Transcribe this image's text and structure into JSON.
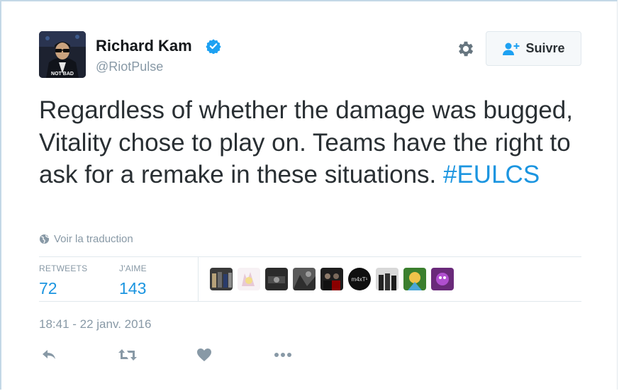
{
  "author": {
    "name": "Richard Kam",
    "handle": "@RiotPulse",
    "avatar_caption": "NOT BAD"
  },
  "header": {
    "settings_icon": "gear-icon",
    "follow_icon": "follow-user-icon",
    "follow_label": "Suivre"
  },
  "tweet": {
    "text": "Regardless of whether the damage was bugged, Vitality chose to play on. Teams have the right to ask for a remake in these situations. ",
    "hashtag": "#EULCS",
    "translate_label": "Voir la traduction"
  },
  "stats": {
    "retweets_label": "RETWEETS",
    "retweets": "72",
    "likes_label": "J'AIME",
    "likes": "143"
  },
  "likers": {
    "count": 9,
    "badge_text": "m4xT¹"
  },
  "timestamp": "18:41 - 22 janv. 2016",
  "actions": [
    "reply-icon",
    "retweet-icon",
    "like-icon",
    "more-icon"
  ],
  "colors": {
    "link": "#1b95e0",
    "verified": "#1da1f2",
    "muted": "#8899a6",
    "text": "#292f33"
  }
}
